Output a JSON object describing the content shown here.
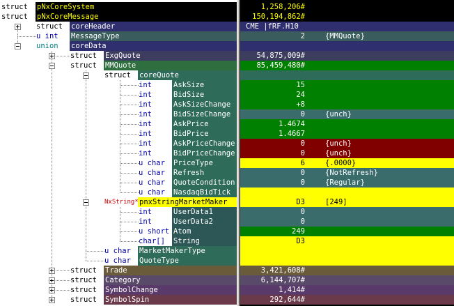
{
  "colors": {
    "root_bg": "#000000",
    "root_name": "#ffff00",
    "header_bg": "#2f2f6f",
    "msgtype_bg": "#3a5c5c",
    "exgquote_bg": "#3d3d5f",
    "mmquote_bg": "#2f6f3f",
    "quote_bg": "#2e6b58",
    "green": "#008000",
    "teal": "#3a6c6c",
    "darkred": "#800000",
    "yellow": "#ffff00",
    "mm_bg": "#2d5656",
    "trade_bg": "#6a5c3a",
    "category_bg": "#5a4a6a",
    "symbolchange_bg": "#5a3a6a",
    "symbolspin_bg": "#6a3a4a",
    "kw_blue": "#0000aa",
    "kw_teal": "#008080",
    "kw_red": "#cc0000",
    "name_light": "#c8d8d8",
    "value_light": "#e0e0e0"
  },
  "rows": [
    {
      "id": "pnxcoresystem",
      "kw": "struct",
      "name": "pNxCoreSystem",
      "value": "1,258,206#",
      "note": "",
      "vtype": "num",
      "depth": 0,
      "toggle": "",
      "kw_color": "#000000",
      "kw_bg": "#ffffff",
      "name_color": "#ffff00",
      "name_bg": "#000000",
      "val_bg": "#000000",
      "val_color": "#ffff00"
    },
    {
      "id": "pnxcoremessage",
      "kw": "struct",
      "name": "pNxCoreMessage",
      "value": "150,194,862#",
      "note": "",
      "vtype": "num",
      "depth": 0,
      "toggle": "",
      "kw_color": "#000000",
      "kw_bg": "#ffffff",
      "name_color": "#ffff00",
      "name_bg": "#000000",
      "val_bg": "#000000",
      "val_color": "#ffff00"
    },
    {
      "id": "coreheader",
      "kw": "struct",
      "name": "coreHeader",
      "value": "CME |fRF.H10",
      "note": "",
      "vtype": "text",
      "depth": 1,
      "toggle": "plus",
      "kw_color": "#000000",
      "kw_bg": "#ffffff",
      "name_color": "#ffffff",
      "name_bg": "#2f2f6f",
      "val_bg": "#2f2f6f",
      "val_color": "#ffffff"
    },
    {
      "id": "messagetype",
      "kw": "u int",
      "name": "MessageType",
      "value": "2",
      "note": "{MMQuote}",
      "vtype": "num",
      "depth": 1,
      "toggle": "",
      "kw_color": "#0000aa",
      "kw_bg": "#ffffff",
      "name_color": "#ffffff",
      "name_bg": "#3a5c5c",
      "val_bg": "#3a5c5c",
      "val_color": "#ffffff"
    },
    {
      "id": "coredata",
      "kw": "union",
      "name": "coreData",
      "value": "",
      "note": "",
      "vtype": "num",
      "depth": 1,
      "toggle": "minus",
      "kw_color": "#008080",
      "kw_bg": "#ffffff",
      "name_color": "#ffffff",
      "name_bg": "#2f2f6f",
      "val_bg": "#2f2f6f",
      "val_color": "#ffffff"
    },
    {
      "id": "exgquote",
      "kw": "struct",
      "name": "ExgQuote",
      "value": "54,875,009#",
      "note": "",
      "vtype": "num",
      "depth": 2,
      "toggle": "plus",
      "kw_color": "#000000",
      "kw_bg": "#ffffff",
      "name_color": "#ffffff",
      "name_bg": "#3d3d5f",
      "val_bg": "#3d3d5f",
      "val_color": "#ffffff"
    },
    {
      "id": "mmquote",
      "kw": "struct",
      "name": "MMQuote",
      "value": "85,459,480#",
      "note": "",
      "vtype": "num",
      "depth": 2,
      "toggle": "minus",
      "kw_color": "#000000",
      "kw_bg": "#ffffff",
      "name_color": "#ffffff",
      "name_bg": "#2f6f3f",
      "val_bg": "#008000",
      "val_color": "#ffffff"
    },
    {
      "id": "corequote",
      "kw": "struct",
      "name": "coreQuote",
      "value": "",
      "note": "",
      "vtype": "num",
      "depth": 3,
      "toggle": "minus",
      "kw_color": "#000000",
      "kw_bg": "#ffffff",
      "name_color": "#ffffff",
      "name_bg": "#2e6b58",
      "val_bg": "#2e6b58",
      "val_color": "#ffffff"
    },
    {
      "id": "asksize",
      "kw": "int",
      "name": "AskSize",
      "value": "15",
      "note": "",
      "vtype": "num",
      "depth": 4,
      "toggle": "",
      "kw_color": "#0000aa",
      "kw_bg": "#ffffff",
      "name_color": "#ffffff",
      "name_bg": "#2e6b58",
      "val_bg": "#008000",
      "val_color": "#ffffff"
    },
    {
      "id": "bidsize",
      "kw": "int",
      "name": "BidSize",
      "value": "24",
      "note": "",
      "vtype": "num",
      "depth": 4,
      "toggle": "",
      "kw_color": "#0000aa",
      "kw_bg": "#ffffff",
      "name_color": "#ffffff",
      "name_bg": "#2e6b58",
      "val_bg": "#008000",
      "val_color": "#ffffff"
    },
    {
      "id": "asksizechange",
      "kw": "int",
      "name": "AskSizeChange",
      "value": "+8",
      "note": "",
      "vtype": "num",
      "depth": 4,
      "toggle": "",
      "kw_color": "#0000aa",
      "kw_bg": "#ffffff",
      "name_color": "#ffffff",
      "name_bg": "#2e6b58",
      "val_bg": "#008000",
      "val_color": "#ffffff"
    },
    {
      "id": "bidsizechange",
      "kw": "int",
      "name": "BidSizeChange",
      "value": "0",
      "note": "{unch}",
      "vtype": "num",
      "depth": 4,
      "toggle": "",
      "kw_color": "#0000aa",
      "kw_bg": "#ffffff",
      "name_color": "#ffffff",
      "name_bg": "#2e6b58",
      "val_bg": "#3a6c6c",
      "val_color": "#ffffff"
    },
    {
      "id": "askprice",
      "kw": "int",
      "name": "AskPrice",
      "value": "1.4674",
      "note": "",
      "vtype": "num",
      "depth": 4,
      "toggle": "",
      "kw_color": "#0000aa",
      "kw_bg": "#ffffff",
      "name_color": "#ffffff",
      "name_bg": "#2e6b58",
      "val_bg": "#008000",
      "val_color": "#ffffff"
    },
    {
      "id": "bidprice",
      "kw": "int",
      "name": "BidPrice",
      "value": "1.4667",
      "note": "",
      "vtype": "num",
      "depth": 4,
      "toggle": "",
      "kw_color": "#0000aa",
      "kw_bg": "#ffffff",
      "name_color": "#ffffff",
      "name_bg": "#2e6b58",
      "val_bg": "#008000",
      "val_color": "#ffffff"
    },
    {
      "id": "askpricechange",
      "kw": "int",
      "name": "AskPriceChange",
      "value": "0",
      "note": "{unch}",
      "vtype": "num",
      "depth": 4,
      "toggle": "",
      "kw_color": "#0000aa",
      "kw_bg": "#ffffff",
      "name_color": "#ffffff",
      "name_bg": "#2e6b58",
      "val_bg": "#800000",
      "val_color": "#ffffff"
    },
    {
      "id": "bidpricechange",
      "kw": "int",
      "name": "BidPriceChange",
      "value": "0",
      "note": "{unch}",
      "vtype": "num",
      "depth": 4,
      "toggle": "",
      "kw_color": "#0000aa",
      "kw_bg": "#ffffff",
      "name_color": "#ffffff",
      "name_bg": "#2e6b58",
      "val_bg": "#800000",
      "val_color": "#ffffff"
    },
    {
      "id": "pricetype",
      "kw": "u char",
      "name": "PriceType",
      "value": "6",
      "note": "{.0000}",
      "vtype": "num",
      "depth": 4,
      "toggle": "",
      "kw_color": "#0000aa",
      "kw_bg": "#ffffff",
      "name_color": "#ffffff",
      "name_bg": "#2e6b58",
      "val_bg": "#ffff00",
      "val_color": "#000000"
    },
    {
      "id": "refresh",
      "kw": "u char",
      "name": "Refresh",
      "value": "0",
      "note": "{NotRefresh}",
      "vtype": "num",
      "depth": 4,
      "toggle": "",
      "kw_color": "#0000aa",
      "kw_bg": "#ffffff",
      "name_color": "#ffffff",
      "name_bg": "#2e6b58",
      "val_bg": "#3a6c6c",
      "val_color": "#ffffff"
    },
    {
      "id": "quotecondition",
      "kw": "u char",
      "name": "QuoteCondition",
      "value": "0",
      "note": "{Regular}",
      "vtype": "num",
      "depth": 4,
      "toggle": "",
      "kw_color": "#0000aa",
      "kw_bg": "#ffffff",
      "name_color": "#ffffff",
      "name_bg": "#2e6b58",
      "val_bg": "#3a6c6c",
      "val_color": "#ffffff"
    },
    {
      "id": "nasdaqbidtick",
      "kw": "u char",
      "name": "NasdaqBidTick",
      "value": "",
      "note": "",
      "vtype": "num",
      "depth": 4,
      "toggle": "",
      "kw_color": "#0000aa",
      "kw_bg": "#ffffff",
      "name_color": "#ffffff",
      "name_bg": "#2e6b58",
      "val_bg": "#ffff00",
      "val_color": "#000000"
    },
    {
      "id": "pnxstringmarketmaker",
      "kw": "NxString*",
      "name": "pnxStringMarketMaker",
      "value": "D3",
      "note": "[249]",
      "vtype": "num",
      "depth": 3,
      "toggle": "minus",
      "kw_color": "#cc0000",
      "kw_bg": "#ffffff",
      "name_color": "#000000",
      "name_bg": "#ffff00",
      "val_bg": "#ffff00",
      "val_color": "#000000"
    },
    {
      "id": "userdata1",
      "kw": "int",
      "name": "UserData1",
      "value": "0",
      "note": "",
      "vtype": "num",
      "depth": 4,
      "toggle": "",
      "kw_color": "#0000aa",
      "kw_bg": "#ffffff",
      "name_color": "#ffffff",
      "name_bg": "#2d5656",
      "val_bg": "#3a6c6c",
      "val_color": "#ffffff"
    },
    {
      "id": "userdata2",
      "kw": "int",
      "name": "UserData2",
      "value": "0",
      "note": "",
      "vtype": "num",
      "depth": 4,
      "toggle": "",
      "kw_color": "#0000aa",
      "kw_bg": "#ffffff",
      "name_color": "#ffffff",
      "name_bg": "#2d5656",
      "val_bg": "#3a6c6c",
      "val_color": "#ffffff"
    },
    {
      "id": "atom",
      "kw": "u short",
      "name": "Atom",
      "value": "249",
      "note": "",
      "vtype": "num",
      "depth": 4,
      "toggle": "",
      "kw_color": "#0000aa",
      "kw_bg": "#ffffff",
      "name_color": "#ffffff",
      "name_bg": "#2d5656",
      "val_bg": "#008000",
      "val_color": "#ffffff"
    },
    {
      "id": "string",
      "kw": "char[]",
      "name": "String",
      "value": "D3",
      "note": "",
      "vtype": "num",
      "depth": 4,
      "toggle": "",
      "kw_color": "#0000aa",
      "kw_bg": "#ffffff",
      "name_color": "#ffffff",
      "name_bg": "#2d5656",
      "val_bg": "#ffff00",
      "val_color": "#000000"
    },
    {
      "id": "marketmakertype",
      "kw": "u char",
      "name": "MarketMakerType",
      "value": "",
      "note": "",
      "vtype": "num",
      "depth": 3,
      "toggle": "",
      "kw_color": "#0000aa",
      "kw_bg": "#ffffff",
      "name_color": "#ffffff",
      "name_bg": "#2e6b58",
      "val_bg": "#ffff00",
      "val_color": "#000000"
    },
    {
      "id": "quotetype",
      "kw": "u char",
      "name": "QuoteType",
      "value": "",
      "note": "",
      "vtype": "num",
      "depth": 3,
      "toggle": "",
      "kw_color": "#0000aa",
      "kw_bg": "#ffffff",
      "name_color": "#ffffff",
      "name_bg": "#2e6b58",
      "val_bg": "#ffff00",
      "val_color": "#000000"
    },
    {
      "id": "trade",
      "kw": "struct",
      "name": "Trade",
      "value": "3,421,608#",
      "note": "",
      "vtype": "num",
      "depth": 2,
      "toggle": "plus",
      "kw_color": "#000000",
      "kw_bg": "#ffffff",
      "name_color": "#ffffff",
      "name_bg": "#6a5c3a",
      "val_bg": "#6a5c3a",
      "val_color": "#ffffff"
    },
    {
      "id": "category",
      "kw": "struct",
      "name": "Category",
      "value": "6,144,707#",
      "note": "",
      "vtype": "num",
      "depth": 2,
      "toggle": "plus",
      "kw_color": "#000000",
      "kw_bg": "#ffffff",
      "name_color": "#ffffff",
      "name_bg": "#5a4a6a",
      "val_bg": "#5a4a6a",
      "val_color": "#ffffff"
    },
    {
      "id": "symbolchange",
      "kw": "struct",
      "name": "SymbolChange",
      "value": "1,414#",
      "note": "",
      "vtype": "num",
      "depth": 2,
      "toggle": "plus",
      "kw_color": "#000000",
      "kw_bg": "#ffffff",
      "name_color": "#ffffff",
      "name_bg": "#5a3a6a",
      "val_bg": "#5a3a6a",
      "val_color": "#ffffff"
    },
    {
      "id": "symbolspin",
      "kw": "struct",
      "name": "SymbolSpin",
      "value": "292,644#",
      "note": "",
      "vtype": "num",
      "depth": 2,
      "toggle": "plus",
      "kw_color": "#000000",
      "kw_bg": "#ffffff",
      "name_color": "#ffffff",
      "name_bg": "#6a3a4a",
      "val_bg": "#6a3a4a",
      "val_color": "#ffffff"
    }
  ]
}
